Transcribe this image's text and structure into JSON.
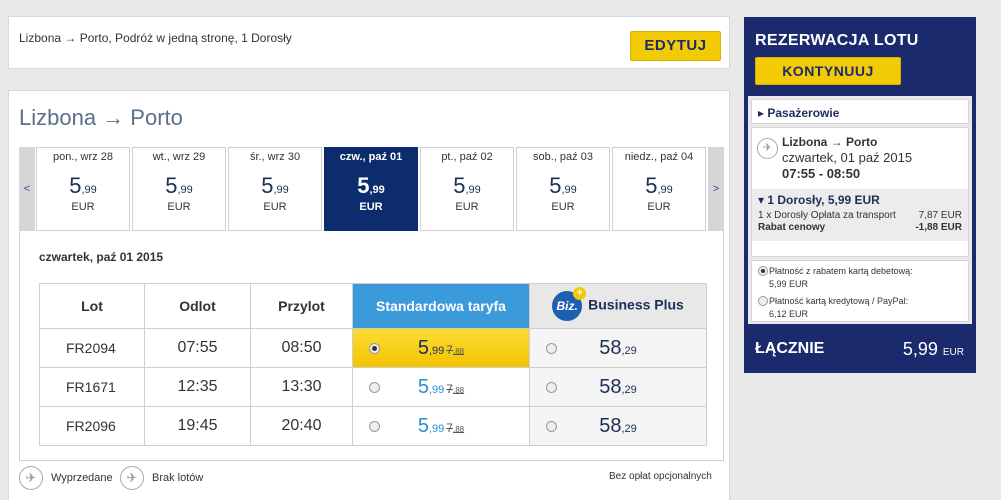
{
  "summary": {
    "text": "Lizbona → Porto, Podróż w jedną stronę, 1 Dorosły",
    "edit_label": "EDYTUJ"
  },
  "main": {
    "route_title": "Lizbona → Porto",
    "arrow_left": "<",
    "arrow_right": ">",
    "days": [
      {
        "label": "pon., wrz 28",
        "price_int": "5",
        "price_dec": ",99",
        "currency": "EUR",
        "active": false
      },
      {
        "label": "wt., wrz 29",
        "price_int": "5",
        "price_dec": ",99",
        "currency": "EUR",
        "active": false
      },
      {
        "label": "śr., wrz 30",
        "price_int": "5",
        "price_dec": ",99",
        "currency": "EUR",
        "active": false
      },
      {
        "label": "czw., paź 01",
        "price_int": "5",
        "price_dec": ",99",
        "currency": "EUR",
        "active": true
      },
      {
        "label": "pt., paź 02",
        "price_int": "5",
        "price_dec": ",99",
        "currency": "EUR",
        "active": false
      },
      {
        "label": "sob., paź 03",
        "price_int": "5",
        "price_dec": ",99",
        "currency": "EUR",
        "active": false
      },
      {
        "label": "niedz., paź 04",
        "price_int": "5",
        "price_dec": ",99",
        "currency": "EUR",
        "active": false
      }
    ],
    "date_heading": "czwartek, paź 01 2015",
    "table": {
      "col_flight": "Lot",
      "col_depart": "Odlot",
      "col_arrive": "Przylot",
      "col_standard": "Standardowa taryfa",
      "col_business": "Business Plus",
      "biz_badge": "Biz.",
      "biz_plus": "+",
      "rows": [
        {
          "flight": "FR2094",
          "depart": "07:55",
          "arrive": "08:50",
          "std_int": "5",
          "std_dec": ",99",
          "old_int": "7",
          "old_dec": ",88",
          "biz_int": "58",
          "biz_dec": ",29",
          "selected": true
        },
        {
          "flight": "FR1671",
          "depart": "12:35",
          "arrive": "13:30",
          "std_int": "5",
          "std_dec": ",99",
          "old_int": "7",
          "old_dec": ",88",
          "biz_int": "58",
          "biz_dec": ",29",
          "selected": false
        },
        {
          "flight": "FR2096",
          "depart": "19:45",
          "arrive": "20:40",
          "std_int": "5",
          "std_dec": ",99",
          "old_int": "7",
          "old_dec": ",88",
          "biz_int": "58",
          "biz_dec": ",29",
          "selected": false
        }
      ]
    },
    "legend": {
      "sold_out": "Wyprzedane",
      "no_flights": "Brak lotów",
      "no_fees": "Bez opłat opcjonalnych"
    }
  },
  "sidebar": {
    "title": "REZERWACJA LOTU",
    "continue_label": "KONTYNUUJ",
    "passengers_label": "▸ Pasażerowie",
    "route": "Lizbona → Porto",
    "date": "czwartek, 01 paź 2015",
    "time": "07:55 - 08:50",
    "adult_label": "▾ 1 Dorosły, 5,99 EUR",
    "fee_label": "1 x Dorosły Opłata za transport",
    "fee_value": "7,87 EUR",
    "discount_label": "Rabat cenowy",
    "discount_value": "-1,88 EUR",
    "pay_debit": "Płatność z rabatem kartą debetową:",
    "pay_debit_value": "5,99 EUR",
    "pay_credit": "Płatność kartą kredytową / PayPal:",
    "pay_credit_value": "6,12 EUR",
    "total_label": "ŁĄCZNIE",
    "total_int": "5,99",
    "total_cur": "EUR"
  },
  "colors": {
    "navy": "#1a2a6c",
    "yellow": "#f3cb05",
    "blue": "#3b9ad9"
  }
}
